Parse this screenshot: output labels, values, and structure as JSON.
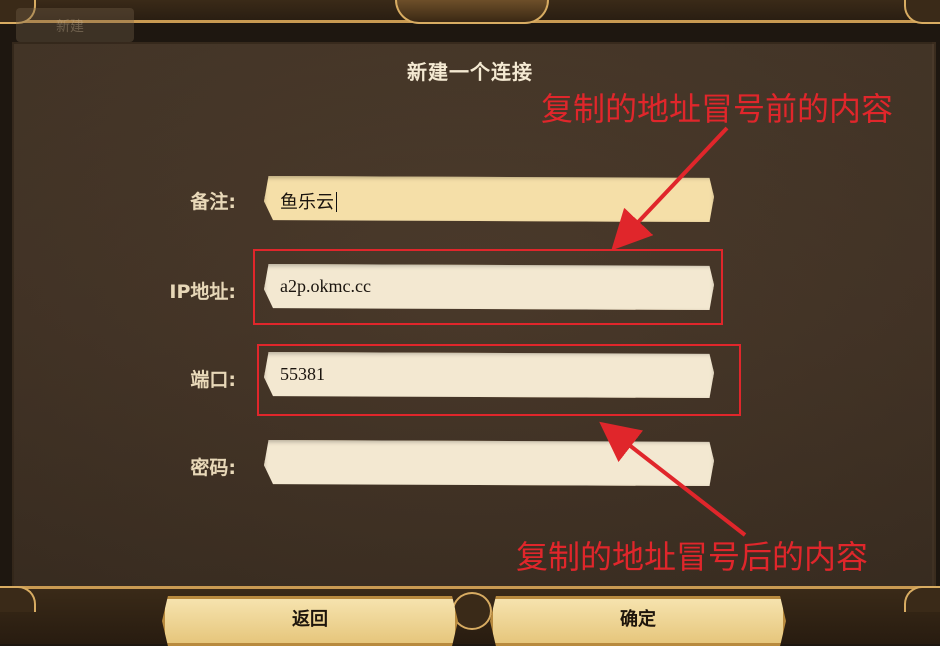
{
  "background_tab": {
    "label": "新建"
  },
  "dialog": {
    "title": "新建一个连接"
  },
  "form": {
    "fields": [
      {
        "label": "备注:",
        "value": "鱼乐云",
        "focused": true
      },
      {
        "label": "IP地址:",
        "value": "a2p.okmc.cc",
        "focused": false
      },
      {
        "label": "端口:",
        "value": "55381",
        "focused": false
      },
      {
        "label": "密码:",
        "value": "",
        "focused": false
      }
    ]
  },
  "buttons": {
    "back_label": "返回",
    "confirm_label": "确定"
  },
  "annotations": {
    "top": "复制的地址冒号前的内容",
    "bottom": "复制的地址冒号后的内容",
    "color": "#e0262b"
  },
  "colors": {
    "panel": "#463628",
    "input": "#f3e8d1",
    "input_focused": "#f5dfa8",
    "button": "#edd08e",
    "label": "#e8d8b8"
  }
}
